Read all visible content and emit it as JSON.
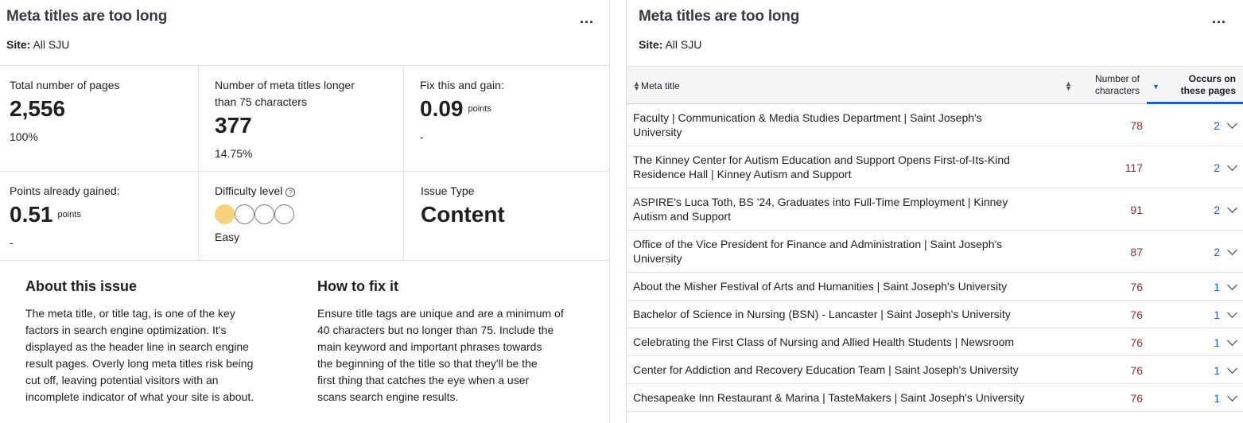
{
  "left_panel": {
    "title": "Meta titles are too long",
    "more_label": "...",
    "site_label": "Site:",
    "site_value": "All SJU",
    "stats": {
      "total_pages_label": "Total number of pages",
      "total_pages_value": "2,556",
      "total_pages_sub": "100%",
      "long_titles_label_line1": "Number of meta titles longer",
      "long_titles_label_line2": "than 75 characters",
      "long_titles_value": "377",
      "long_titles_sub": "14.75%",
      "fix_gain_label": "Fix this and gain:",
      "fix_gain_value": "0.09",
      "fix_gain_unit": "points",
      "fix_gain_sub": "-",
      "gained_label": "Points already gained:",
      "gained_value": "0.51",
      "gained_unit": "points",
      "gained_sub": "-",
      "difficulty_label": "Difficulty level",
      "difficulty_help": "?",
      "difficulty_level": 1,
      "difficulty_max": 4,
      "difficulty_text": "Easy",
      "issue_type_label": "Issue Type",
      "issue_type_value": "Content"
    },
    "about": {
      "title": "About this issue",
      "lines": [
        "The meta title, or title tag, is one of the key",
        "factors in search engine optimization. It's",
        "displayed as the header line in search engine",
        "result pages. Overly long meta titles risk being",
        "cut off, leaving potential visitors with an",
        "incomplete indicator of what your site is about."
      ]
    },
    "howto": {
      "title": "How to fix it",
      "lines": [
        "Ensure title tags are unique and are a minimum of",
        "40 characters but no longer than 75. Include the",
        "main keyword and important phrases towards",
        "the beginning of the title so that they'll be the",
        "first thing that catches the eye when a user",
        "scans search engine results."
      ]
    }
  },
  "right_panel": {
    "title": "Meta titles are too long",
    "more_label": "...",
    "site_label": "Site:",
    "site_value": "All SJU",
    "columns": {
      "meta_title": "Meta title",
      "chars_line1": "Number of",
      "chars_line2": "characters",
      "occurs_line1": "Occurs on",
      "occurs_line2": "these pages"
    },
    "rows": [
      {
        "title_l1": "Faculty | Communication & Media Studies Department | Saint Joseph's",
        "title_l2": "University",
        "chars": "78",
        "occurs": "2"
      },
      {
        "title_l1": "The Kinney Center for Autism Education and Support Opens First-of-Its-Kind",
        "title_l2": "Residence Hall | Kinney Autism and Support",
        "chars": "117",
        "occurs": "2"
      },
      {
        "title_l1": "ASPIRE's Luca Toth, BS '24, Graduates into Full-Time Employment | Kinney",
        "title_l2": "Autism and Support",
        "chars": "91",
        "occurs": "2"
      },
      {
        "title_l1": "Office of the Vice President for Finance and Administration | Saint Joseph's",
        "title_l2": "University",
        "chars": "87",
        "occurs": "2"
      },
      {
        "title_l1": "About the Misher Festival of Arts and Humanities | Saint Joseph's University",
        "title_l2": "",
        "chars": "76",
        "occurs": "1"
      },
      {
        "title_l1": "Bachelor of Science in Nursing (BSN) - Lancaster | Saint Joseph's University",
        "title_l2": "",
        "chars": "76",
        "occurs": "1"
      },
      {
        "title_l1": "Celebrating the First Class of Nursing and Allied Health Students | Newsroom",
        "title_l2": "",
        "chars": "76",
        "occurs": "1"
      },
      {
        "title_l1": "Center for Addiction and Recovery Education Team | Saint Joseph's University",
        "title_l2": "",
        "chars": "76",
        "occurs": "1"
      },
      {
        "title_l1": "Chesapeake Inn Restaurant & Marina | TasteMakers | Saint Joseph's University",
        "title_l2": "",
        "chars": "76",
        "occurs": "1"
      }
    ]
  }
}
